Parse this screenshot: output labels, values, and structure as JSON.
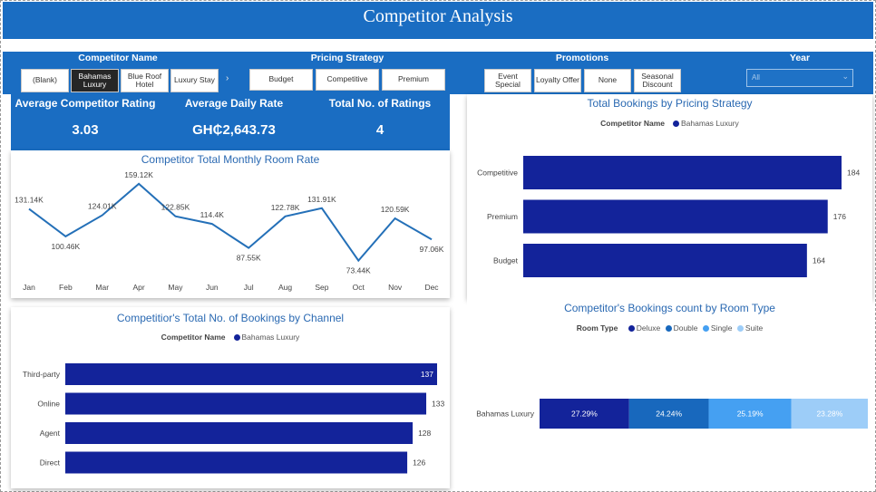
{
  "header": {
    "title": "Competitor Analysis"
  },
  "slicers": {
    "competitor_name": {
      "title": "Competitor Name",
      "options": [
        "(Blank)",
        "Bahamas Luxury",
        "Blue Roof Hotel",
        "Luxury Stay"
      ],
      "selected": "Bahamas Luxury"
    },
    "pricing_strategy": {
      "title": "Pricing Strategy",
      "options": [
        "Budget",
        "Competitive",
        "Premium"
      ]
    },
    "promotions": {
      "title": "Promotions",
      "options": [
        "Event Special",
        "Loyalty Offer",
        "None",
        "Seasonal Discount"
      ]
    },
    "year": {
      "title": "Year",
      "value": "All"
    }
  },
  "kpis": [
    {
      "label": "Average Competitor Rating",
      "value": "3.03"
    },
    {
      "label": "Average Daily Rate",
      "value": "GH₵2,643.73"
    },
    {
      "label": "Total No. of Ratings",
      "value": "4"
    }
  ],
  "colors": {
    "accent": "#1a6dc2",
    "bar": "#13239a",
    "line": "#2470b8",
    "deluxe": "#13239a",
    "double": "#1868bd",
    "single": "#45a0f2",
    "suite": "#9dcdf8"
  },
  "chart_data": [
    {
      "type": "line",
      "title": "Competitor Total Monthly Room Rate",
      "categories": [
        "Jan",
        "Feb",
        "Mar",
        "Apr",
        "May",
        "Jun",
        "Jul",
        "Aug",
        "Sep",
        "Oct",
        "Nov",
        "Dec"
      ],
      "values": [
        131.14,
        100.46,
        124.01,
        159.12,
        122.85,
        114.4,
        87.55,
        122.78,
        131.91,
        73.44,
        120.59,
        97.06
      ],
      "labels": [
        "131.14K",
        "100.46K",
        "124.01K",
        "159.12K",
        "122.85K",
        "114.4K",
        "87.55K",
        "122.78K",
        "131.91K",
        "73.44K",
        "120.59K",
        "97.06K"
      ]
    },
    {
      "type": "bar",
      "title": "Total Bookings by Pricing Strategy",
      "legend_title": "Competitor Name",
      "legend": [
        "Bahamas Luxury"
      ],
      "categories": [
        "Competitive",
        "Premium",
        "Budget"
      ],
      "values": [
        184,
        176,
        164
      ]
    },
    {
      "type": "bar",
      "title": "Competitior's Total No. of Bookings by Channel",
      "legend_title": "Competitor Name",
      "legend": [
        "Bahamas Luxury"
      ],
      "categories": [
        "Third-party",
        "Online",
        "Agent",
        "Direct"
      ],
      "values": [
        137,
        133,
        128,
        126
      ]
    },
    {
      "type": "bar",
      "stacked": "100%",
      "title": "Competitor's Bookings count by Room Type",
      "legend_title": "Room Type",
      "categories": [
        "Bahamas Luxury"
      ],
      "series": [
        {
          "name": "Deluxe",
          "values": [
            27.29
          ],
          "label": "27.29%"
        },
        {
          "name": "Double",
          "values": [
            24.24
          ],
          "label": "24.24%"
        },
        {
          "name": "Single",
          "values": [
            25.19
          ],
          "label": "25.19%"
        },
        {
          "name": "Suite",
          "values": [
            23.28
          ],
          "label": "23.28%"
        }
      ]
    }
  ]
}
